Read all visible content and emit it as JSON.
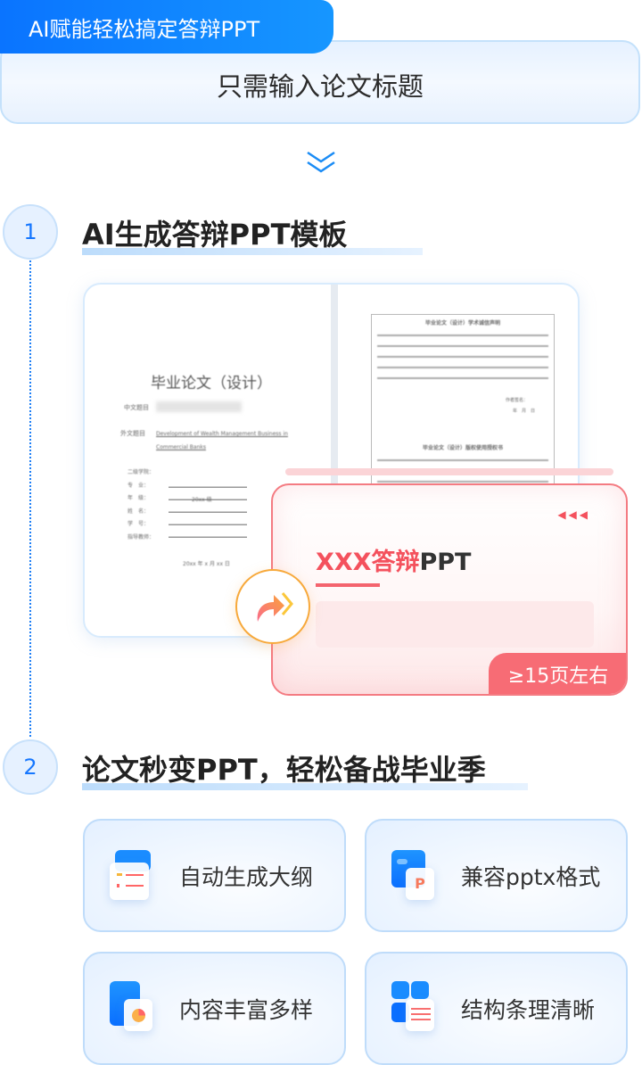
{
  "header": {
    "tab_label": "AI赋能轻松搞定答辩PPT",
    "subtitle": "只需输入论文标题"
  },
  "steps": [
    {
      "number": "1",
      "title": "AI生成答辩PPT模板"
    },
    {
      "number": "2",
      "title": "论文秒变PPT，轻松备战毕业季"
    }
  ],
  "doc_preview": {
    "cover_title": "毕业论文（设计）",
    "cn_title_label": "中文题目",
    "en_title_label": "外文题目",
    "en_title": "Development of Wealth Management Business in Commercial Banks",
    "fields": [
      "二级学院：",
      "专　业：",
      "年　级：",
      "姓　名：",
      "学　号：",
      "指导教师："
    ],
    "grade_value": "20xx 级",
    "date": "20xx 年 x 月 xx 日",
    "page2_heading": "毕业论文（设计）学术诚信声明",
    "page2_heading2": "毕业论文（设计）版权使用授权书",
    "signature": "作者签名：",
    "date_short": "年　月　日"
  },
  "ppt_preview": {
    "title_red": "XXX答辩",
    "title_dark": "PPT",
    "badge": "≥15页左右"
  },
  "features": [
    {
      "label": "自动生成大纲",
      "icon": "outline-list-icon"
    },
    {
      "label": "兼容pptx格式",
      "icon": "pptx-file-icon"
    },
    {
      "label": "内容丰富多样",
      "icon": "pie-chart-doc-icon"
    },
    {
      "label": "结构条理清晰",
      "icon": "grid-structure-icon"
    }
  ],
  "colors": {
    "primary": "#1677ff",
    "accent_red": "#f4515d",
    "accent_orange": "#f7a93b"
  }
}
